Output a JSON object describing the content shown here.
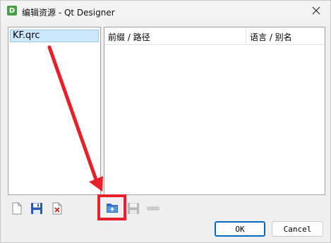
{
  "window": {
    "title": "编辑资源 - Qt Designer",
    "app_icon_letter": "D"
  },
  "resource_files": {
    "items": [
      "KF.qrc"
    ]
  },
  "resource_table": {
    "columns": [
      "前缀 / 路径",
      "语言 / 别名"
    ]
  },
  "file_toolbar": {
    "buttons": [
      "new-file-icon",
      "save-file-icon",
      "remove-file-icon"
    ]
  },
  "resource_toolbar": {
    "buttons": [
      "add-prefix-icon",
      "add-files-icon",
      "remove-icon"
    ]
  },
  "dialog_buttons": {
    "ok": "OK",
    "cancel": "Cancel"
  },
  "annotation": {
    "color": "#e8202a"
  }
}
